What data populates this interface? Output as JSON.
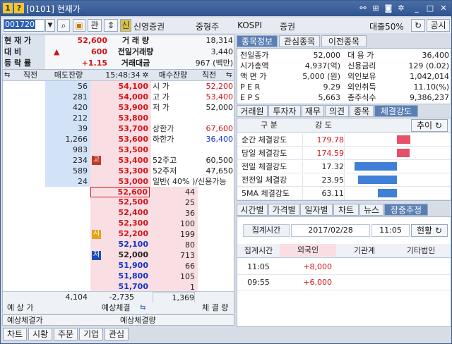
{
  "title": {
    "num1": "1",
    "num2": "?",
    "text": "[0101] 현재가"
  },
  "toolbar": {
    "code": "001720",
    "kwan": "관",
    "sin": "신",
    "name": "신영증권",
    "cap": "중형주",
    "market": "KOSPI",
    "sector": "증권",
    "loan": "대출50%",
    "public": "공시"
  },
  "summary": {
    "rows": [
      {
        "label": "현 재 가",
        "value": "52,600",
        "l2": "거 래 량",
        "v2": "18,314"
      },
      {
        "label": "대    비",
        "arrow": "▲",
        "value": "600",
        "l2": "전일거래량",
        "v2": "3,440"
      },
      {
        "label": "등 락 률",
        "value": "+1.15",
        "l2": "거래대금",
        "v2": "967 (백만)"
      }
    ]
  },
  "orderbook": {
    "headers": {
      "prev": "직전",
      "ask_qty": "매도잔량",
      "time": "15:48:34",
      "bid_qty": "매수잔량",
      "prev2": "직전"
    },
    "asks": [
      {
        "qty": "56",
        "price": "54,100",
        "info_l": "시  가",
        "info_r": "52,200",
        "info_color": "red"
      },
      {
        "qty": "281",
        "price": "54,000",
        "info_l": "고  가",
        "info_r": "53,400",
        "info_color": "red"
      },
      {
        "qty": "420",
        "price": "53,900",
        "info_l": "저  가",
        "info_r": "52,000",
        "info_color": ""
      },
      {
        "qty": "212",
        "price": "53,800",
        "info_l": "",
        "info_r": "",
        "info_color": ""
      },
      {
        "qty": "39",
        "price": "53,700",
        "info_l": "상한가",
        "info_r": "67,600",
        "info_color": "red"
      },
      {
        "qty": "1,266",
        "price": "53,600",
        "info_l": "하한가",
        "info_r": "36,400",
        "info_color": "blue"
      },
      {
        "qty": "983",
        "price": "53,500",
        "info_l": "",
        "info_r": "",
        "info_color": ""
      },
      {
        "qty": "234",
        "price": "53,400",
        "mark": "고",
        "info_l": "52주고",
        "info_r": "60,500",
        "info_color": ""
      },
      {
        "qty": "589",
        "price": "53,300",
        "info_l": "52주저",
        "info_r": "47,650",
        "info_color": ""
      },
      {
        "qty": "24",
        "price": "53,000",
        "info_l": "일반( 40% )/신용가능",
        "info_r": "",
        "info_color": ""
      }
    ],
    "bids": [
      {
        "price": "52,600",
        "qty": "44",
        "current": true
      },
      {
        "price": "52,500",
        "qty": "25"
      },
      {
        "price": "52,400",
        "qty": "36"
      },
      {
        "price": "52,300",
        "qty": "100"
      },
      {
        "price": "52,200",
        "qty": "199",
        "mark": "시"
      },
      {
        "price": "52,100",
        "qty": "80"
      },
      {
        "price": "52,000",
        "qty": "713",
        "mark": "저"
      },
      {
        "price": "51,900",
        "qty": "66"
      },
      {
        "price": "51,800",
        "qty": "105"
      },
      {
        "price": "51,700",
        "qty": "1"
      }
    ],
    "totals": {
      "ask_total": "4,104",
      "diff": "-2,735",
      "bid_total": "1,369"
    },
    "bottom": {
      "expected_price": "예 상 가",
      "expected_exec": "예상체결",
      "exec_qty": "체 결 량"
    },
    "exp_row": {
      "left": "예상체결가",
      "right": "예상체결량"
    }
  },
  "info": {
    "tabs": [
      "종목정보",
      "관심종목",
      "이전종목"
    ],
    "rows": [
      {
        "l1": "전일종가",
        "v1": "52,000",
        "l2": "대 용 가",
        "v2": "36,400"
      },
      {
        "l1": "시가총액",
        "v1": "4,937(억)",
        "l2": "신용금리",
        "v2": "129 (0.02)"
      },
      {
        "l1": "액 면 가",
        "v1": "5,000 (원)",
        "l2": "외인보유",
        "v2": "1,042,014"
      },
      {
        "l1": "P E R",
        "v1": "9.29",
        "l2": "외인취득",
        "v2": "11.10(%)"
      },
      {
        "l1": "E P S",
        "v1": "5,663",
        "l2": "총주식수",
        "v2": "9,386,237"
      }
    ]
  },
  "strength": {
    "tabs": [
      "거래원",
      "투자자",
      "재무",
      "의견",
      "종목",
      "체결강도"
    ],
    "header": {
      "col1": "구    분",
      "col2": "강  도",
      "trend": "추이"
    },
    "rows": [
      {
        "label": "순간 체결강도",
        "value": "179.78",
        "bar": 179.78,
        "color": "red"
      },
      {
        "label": "당일 체결강도",
        "value": "174.59",
        "bar": 174.59,
        "color": "red"
      },
      {
        "label": "전일 체결강도",
        "value": "17.32",
        "bar": 17.32,
        "color": "blue"
      },
      {
        "label": "전전일 체결강",
        "value": "23.95",
        "bar": 23.95,
        "color": "blue"
      },
      {
        "label": "5MA 체결강도",
        "value": "63.11",
        "bar": 63.11,
        "color": "blue"
      }
    ]
  },
  "intraday": {
    "tabs": [
      "시간별",
      "가격별",
      "일자별",
      "차트",
      "뉴스",
      "장중추정"
    ],
    "agg_label": "집계시간",
    "date": "2017/02/28",
    "time": "11:05",
    "status": "현황",
    "columns": [
      "집계시간",
      "외국인",
      "기관계",
      "기타법인"
    ],
    "rows": [
      {
        "time": "11:05",
        "foreign": "+8,000",
        "inst": "",
        "other": ""
      },
      {
        "time": "09:55",
        "foreign": "+6,000",
        "inst": "",
        "other": ""
      }
    ]
  },
  "bottom_buttons": [
    "차트",
    "시황",
    "주문",
    "기업",
    "관심"
  ],
  "colors": {
    "up": "#d2151a",
    "down": "#1434c8",
    "ask_bg": "#d3e3f7",
    "bid_bg": "#f9dfe3",
    "accent": "#5a7fb4"
  }
}
